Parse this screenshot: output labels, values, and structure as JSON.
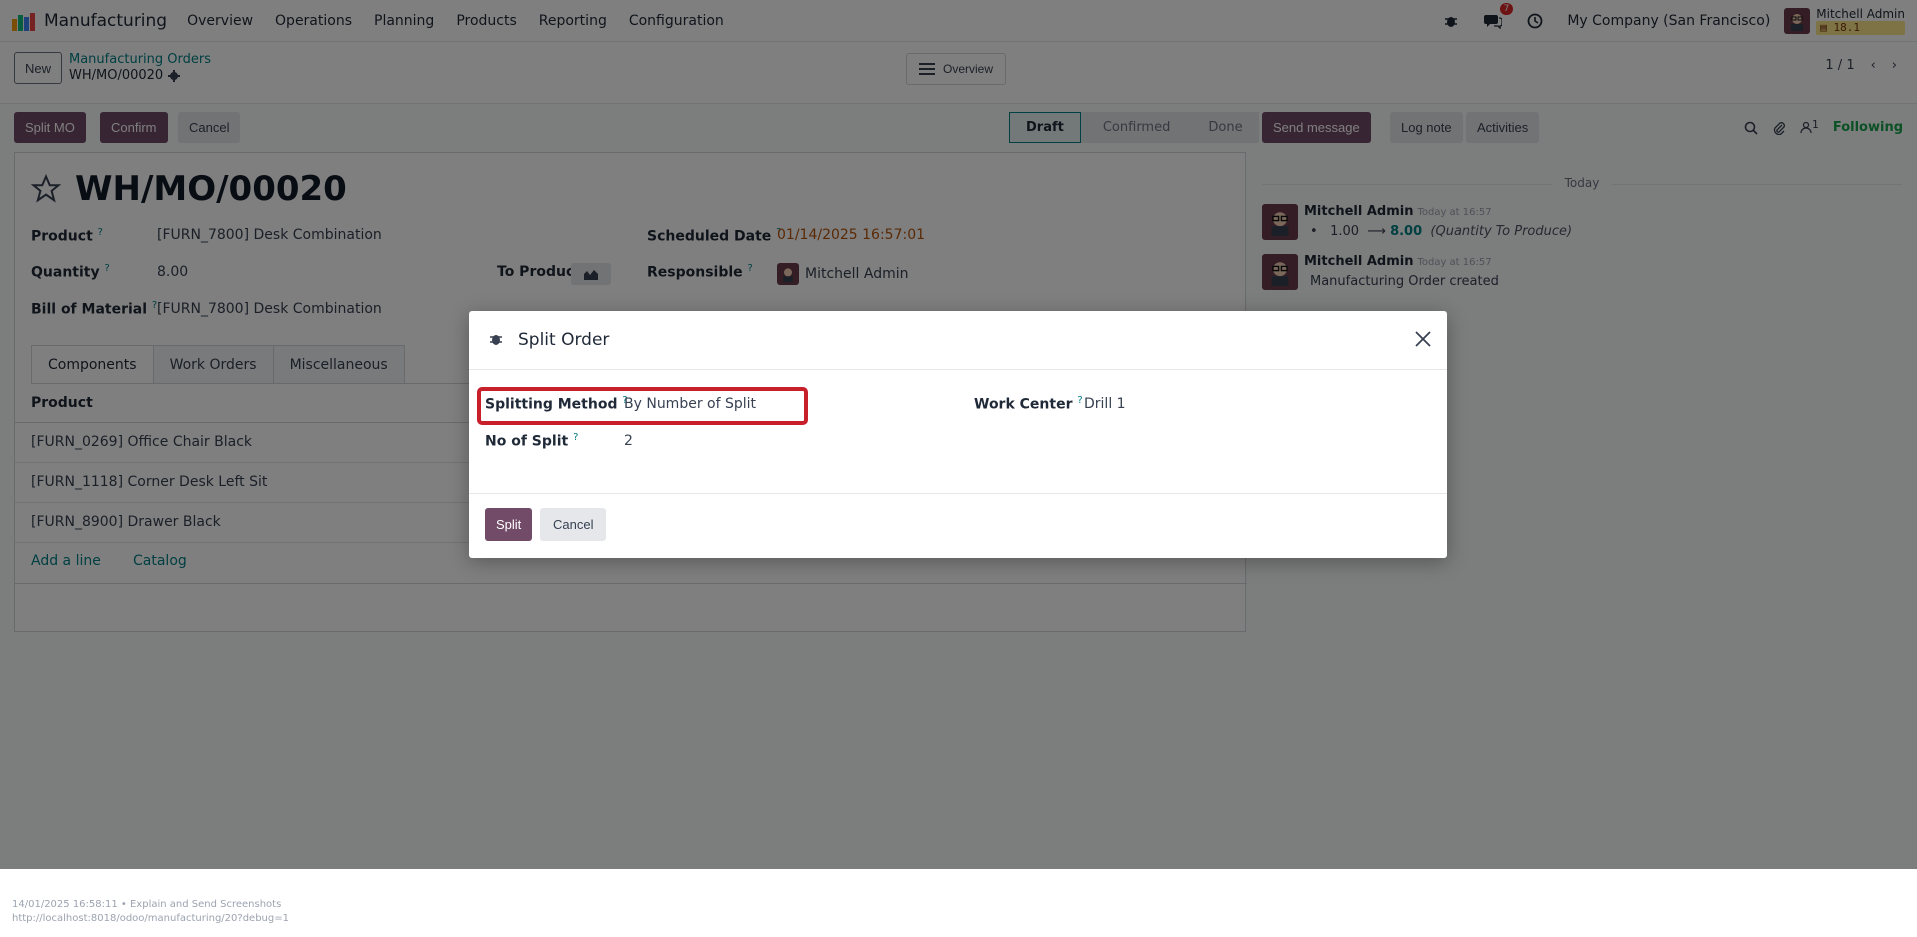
{
  "navbar": {
    "app_name": "Manufacturing",
    "menu": [
      "Overview",
      "Operations",
      "Planning",
      "Products",
      "Reporting",
      "Configuration"
    ],
    "messages_badge": "7",
    "company": "My Company (San Francisco)",
    "user_name": "Mitchell Admin",
    "db_version": "18.1"
  },
  "control": {
    "new_label": "New",
    "breadcrumb_parent": "Manufacturing Orders",
    "breadcrumb_current": "WH/MO/00020",
    "overview_label": "Overview",
    "pager": "1 / 1"
  },
  "actions": {
    "split_mo": "Split MO",
    "confirm": "Confirm",
    "cancel": "Cancel"
  },
  "status": {
    "stages": [
      "Draft",
      "Confirmed",
      "Done"
    ],
    "active": "Draft"
  },
  "form": {
    "title": "WH/MO/00020",
    "product_label": "Product",
    "product_value": "[FURN_7800] Desk Combination",
    "quantity_label": "Quantity",
    "quantity_value": "8.00",
    "to_produce_label": "To Produce",
    "bom_label": "Bill of Material",
    "bom_value": "[FURN_7800] Desk Combination",
    "scheduled_label": "Scheduled Date",
    "scheduled_value": "01/14/2025 16:57:01",
    "responsible_label": "Responsible",
    "responsible_value": "Mitchell Admin",
    "tabs": [
      "Components",
      "Work Orders",
      "Miscellaneous"
    ],
    "table_header": "Product",
    "rows": [
      "[FURN_0269] Office Chair Black",
      "[FURN_1118] Corner Desk Left Sit",
      "[FURN_8900] Drawer Black"
    ],
    "add_line": "Add a line",
    "catalog": "Catalog"
  },
  "chatter": {
    "send_message": "Send message",
    "log_note": "Log note",
    "activities": "Activities",
    "followers_count": "1",
    "following": "Following",
    "today": "Today",
    "messages": [
      {
        "author": "Mitchell Admin",
        "time": "Today at 16:57",
        "old": "1.00",
        "arrow": "⟶",
        "new": "8.00",
        "field": "(Quantity To Produce)"
      },
      {
        "author": "Mitchell Admin",
        "time": "Today at 16:57",
        "body": "Manufacturing Order created"
      }
    ]
  },
  "modal": {
    "title": "Split Order",
    "splitting_method_label": "Splitting Method",
    "splitting_method_value": "By Number of Split",
    "no_of_split_label": "No of Split",
    "no_of_split_value": "2",
    "work_center_label": "Work Center",
    "work_center_value": "Drill 1",
    "split_button": "Split",
    "cancel_button": "Cancel"
  },
  "footer": {
    "line1": "14/01/2025 16:58:11 • Explain and Send Screenshots",
    "line2": "http://localhost:8018/odoo/manufacturing/20?debug=1"
  },
  "colors": {
    "primary": "#714b67",
    "link": "#017e84",
    "highlight": "#c8202b"
  }
}
